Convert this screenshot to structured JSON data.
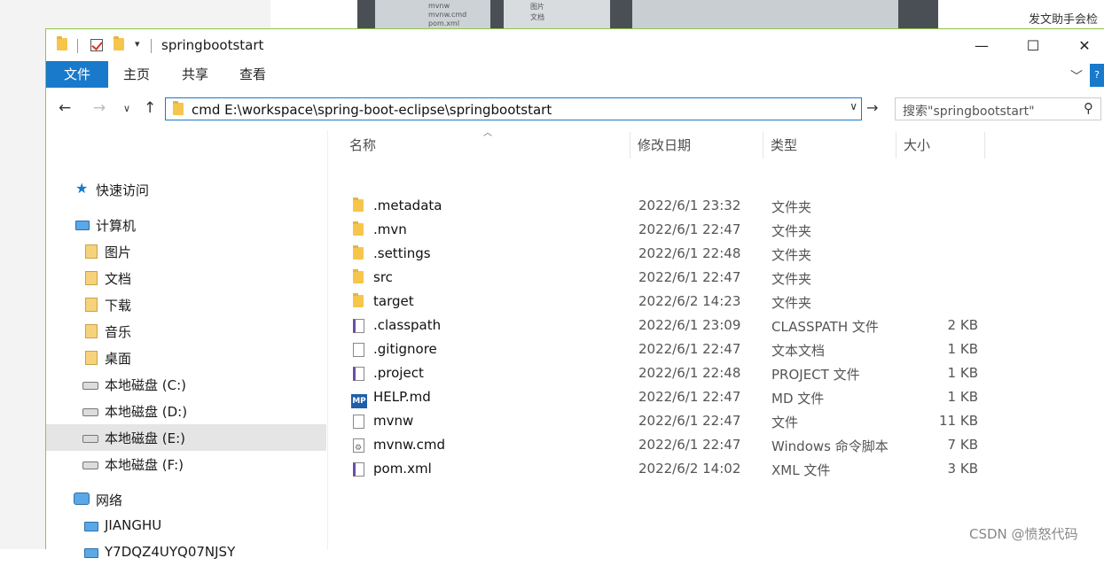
{
  "background": {
    "right_text": "发文助手会检",
    "photo_items": [
      "mvnw",
      "mvnw.cmd",
      "pom.xml",
      "图片",
      "文档"
    ]
  },
  "window": {
    "title": "springbootstart",
    "controls": {
      "minimize": "—",
      "maximize": "☐",
      "close": "✕"
    }
  },
  "ribbon": {
    "tabs": [
      "文件",
      "主页",
      "共享",
      "查看"
    ],
    "active_tab": "文件",
    "accent_color": "#1979ca"
  },
  "navbar": {
    "address": "cmd E:\\workspace\\spring-boot-eclipse\\springbootstart",
    "search_placeholder": "搜索\"springbootstart\""
  },
  "nav_pane": {
    "items": [
      {
        "label": "快速访问",
        "icon": "star-icon",
        "level": 0
      },
      {
        "label": "计算机",
        "icon": "computer-icon",
        "level": 0
      },
      {
        "label": "图片",
        "icon": "pictures-icon",
        "level": 1
      },
      {
        "label": "文档",
        "icon": "documents-icon",
        "level": 1
      },
      {
        "label": "下载",
        "icon": "downloads-icon",
        "level": 1
      },
      {
        "label": "音乐",
        "icon": "music-icon",
        "level": 1
      },
      {
        "label": "桌面",
        "icon": "desktop-icon",
        "level": 1
      },
      {
        "label": "本地磁盘 (C:)",
        "icon": "drive-icon",
        "level": 1
      },
      {
        "label": "本地磁盘 (D:)",
        "icon": "drive-icon",
        "level": 1
      },
      {
        "label": "本地磁盘 (E:)",
        "icon": "drive-icon",
        "level": 1,
        "selected": true
      },
      {
        "label": "本地磁盘 (F:)",
        "icon": "drive-icon",
        "level": 1
      },
      {
        "label": "网络",
        "icon": "network-icon",
        "level": 0
      },
      {
        "label": "JIANGHU",
        "icon": "network-computer-icon",
        "level": 1
      },
      {
        "label": "Y7DQZ4UYQ07NJSY",
        "icon": "network-computer-icon",
        "level": 1
      }
    ]
  },
  "file_list": {
    "columns": [
      "名称",
      "修改日期",
      "类型",
      "大小"
    ],
    "rows": [
      {
        "name": ".metadata",
        "date": "2022/6/1 23:32",
        "type": "文件夹",
        "size": "",
        "icon": "folder-icon"
      },
      {
        "name": ".mvn",
        "date": "2022/6/1 22:47",
        "type": "文件夹",
        "size": "",
        "icon": "folder-icon"
      },
      {
        "name": ".settings",
        "date": "2022/6/1 22:48",
        "type": "文件夹",
        "size": "",
        "icon": "folder-icon"
      },
      {
        "name": "src",
        "date": "2022/6/1 22:47",
        "type": "文件夹",
        "size": "",
        "icon": "folder-icon"
      },
      {
        "name": "target",
        "date": "2022/6/2 14:23",
        "type": "文件夹",
        "size": "",
        "icon": "folder-icon"
      },
      {
        "name": ".classpath",
        "date": "2022/6/1 23:09",
        "type": "CLASSPATH 文件",
        "size": "2 KB",
        "icon": "config-file-icon"
      },
      {
        "name": ".gitignore",
        "date": "2022/6/1 22:47",
        "type": "文本文档",
        "size": "1 KB",
        "icon": "text-file-icon"
      },
      {
        "name": ".project",
        "date": "2022/6/1 22:48",
        "type": "PROJECT 文件",
        "size": "1 KB",
        "icon": "config-file-icon"
      },
      {
        "name": "HELP.md",
        "date": "2022/6/1 22:47",
        "type": "MD 文件",
        "size": "1 KB",
        "icon": "markdown-file-icon"
      },
      {
        "name": "mvnw",
        "date": "2022/6/1 22:47",
        "type": "文件",
        "size": "11 KB",
        "icon": "blank-file-icon"
      },
      {
        "name": "mvnw.cmd",
        "date": "2022/6/1 22:47",
        "type": "Windows 命令脚本",
        "size": "7 KB",
        "icon": "cmd-file-icon"
      },
      {
        "name": "pom.xml",
        "date": "2022/6/2 14:02",
        "type": "XML 文件",
        "size": "3 KB",
        "icon": "config-file-icon"
      }
    ]
  },
  "watermark": "CSDN @愤怒代码"
}
